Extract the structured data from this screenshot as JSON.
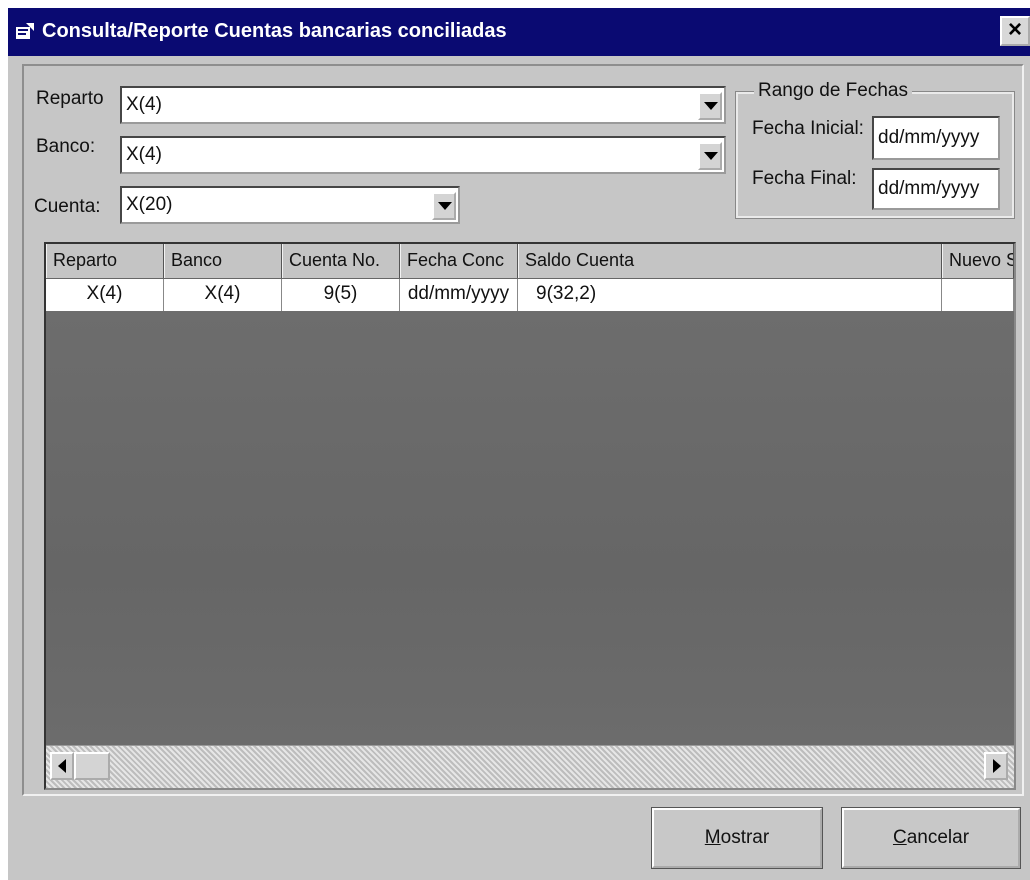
{
  "window": {
    "title": "Consulta/Reporte Cuentas bancarias conciliadas",
    "close_glyph": "×"
  },
  "filters": {
    "reparto": {
      "label": "Reparto",
      "value": "X(4)"
    },
    "banco": {
      "label": "Banco:",
      "value": "X(4)"
    },
    "cuenta": {
      "label": "Cuenta:",
      "value": "X(20)"
    }
  },
  "date_range": {
    "legend": "Rango de Fechas",
    "start": {
      "label": "Fecha Inicial:",
      "value": "dd/mm/yyyy"
    },
    "end": {
      "label": "Fecha Final:",
      "value": "dd/mm/yyyy"
    }
  },
  "grid": {
    "columns": [
      "Reparto",
      "Banco",
      "Cuenta No.",
      "Fecha Conc",
      "Saldo Cuenta",
      "Nuevo S"
    ],
    "rows": [
      [
        "X(4)",
        "X(4)",
        "9(5)",
        "dd/mm/yyyy",
        "9(32,2)",
        ""
      ]
    ]
  },
  "buttons": {
    "mostrar": {
      "accel": "M",
      "rest": "ostrar"
    },
    "cancelar": {
      "accel": "C",
      "rest": "ancelar"
    }
  },
  "colors": {
    "titlebar": "#0a0a72",
    "window_bg": "#c6c6c6",
    "grid_bg": "#707070"
  }
}
